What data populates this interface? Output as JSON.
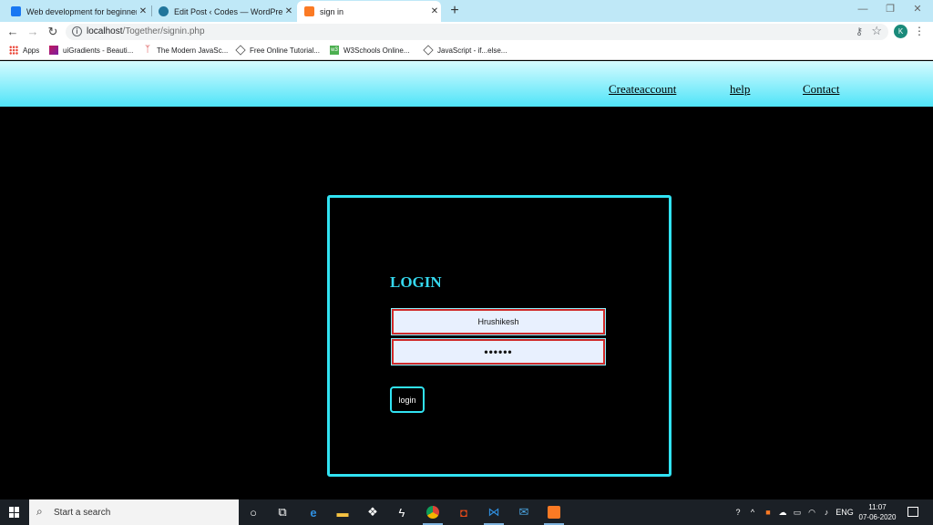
{
  "browser": {
    "tabs": [
      {
        "title": "Web development for beginners",
        "icon": "facebook-icon",
        "color": "#1877f2",
        "active": false
      },
      {
        "title": "Edit Post ‹ Codes — WordPress.c",
        "icon": "wordpress-icon",
        "color": "#21759b",
        "active": false
      },
      {
        "title": "sign in",
        "icon": "xampp-icon",
        "color": "#fb7a24",
        "active": true
      }
    ],
    "new_tab": "+",
    "address": {
      "host": "localhost",
      "path": "/Together/signin.php"
    },
    "profile_initial": "K",
    "bookmarks": [
      {
        "label": "Apps",
        "icon": "apps-grid-icon"
      },
      {
        "label": "uiGradients - Beauti...",
        "icon": "uigradients-icon"
      },
      {
        "label": "The Modern JavaSc...",
        "icon": "javascript-info-icon"
      },
      {
        "label": "Free Online Tutorial...",
        "icon": "tutorials-icon"
      },
      {
        "label": "W3Schools Online...",
        "icon": "w3schools-icon"
      },
      {
        "label": "JavaScript - if...else...",
        "icon": "tutorials-icon"
      }
    ]
  },
  "page": {
    "nav": [
      "Createaccount",
      "help",
      "Contact"
    ],
    "login": {
      "title": "LOGIN",
      "username": "Hrushikesh",
      "password": "••••••",
      "button": "login"
    },
    "colors": {
      "accent": "#31e3f3",
      "input_border": "#d02929",
      "background": "#000000"
    }
  },
  "taskbar": {
    "search_placeholder": "Start a search",
    "language": "ENG",
    "time": "11:07",
    "date": "07-06-2020"
  }
}
